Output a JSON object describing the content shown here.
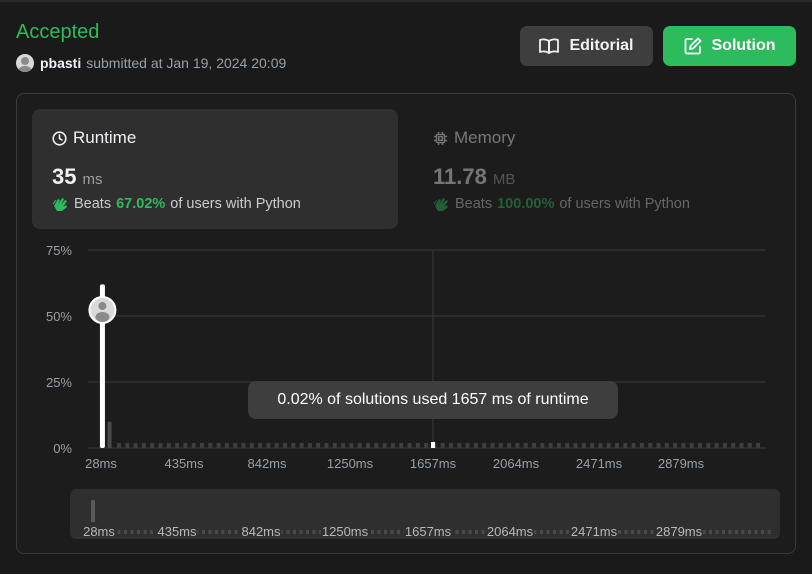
{
  "header": {
    "status": "Accepted",
    "user": "pbasti",
    "submitted_text": "submitted at Jan 19, 2024 20:09",
    "editorial_label": "Editorial",
    "solution_label": "Solution"
  },
  "runtime": {
    "title": "Runtime",
    "value": "35",
    "unit": "ms",
    "beats_prefix": "Beats",
    "beats_pct": "67.02%",
    "beats_suffix": "of users with Python"
  },
  "memory": {
    "title": "Memory",
    "value": "11.78",
    "unit": "MB",
    "beats_prefix": "Beats",
    "beats_pct": "100.00%",
    "beats_suffix": "of users with Python"
  },
  "tooltip": "0.02% of solutions used 1657 ms of runtime",
  "colors": {
    "accent": "#2cbb5d",
    "panel": "#2f2f2f",
    "background": "#1a1a1a"
  },
  "chart_data": {
    "type": "bar",
    "ylabel": "",
    "xlabel": "",
    "y_ticks": [
      "75%",
      "50%",
      "25%",
      "0%"
    ],
    "y_tick_values": [
      75,
      50,
      25,
      0
    ],
    "ylim": [
      0,
      75
    ],
    "x_tick_labels": [
      "28ms",
      "435ms",
      "842ms",
      "1250ms",
      "1657ms",
      "2064ms",
      "2471ms",
      "2879ms"
    ],
    "x_range_ms": [
      28,
      3286
    ],
    "highlight": {
      "x_ms": 35,
      "y_pct": 62,
      "label": "your submission"
    },
    "hover": {
      "x_ms": 1657,
      "y_pct": 0.02
    },
    "grid": true,
    "secondary_peak": {
      "x_ms": 70,
      "y_pct": 10
    }
  },
  "minimap": {
    "x_tick_labels": [
      "28ms",
      "435ms",
      "842ms",
      "1250ms",
      "1657ms",
      "2064ms",
      "2471ms",
      "2879ms"
    ]
  }
}
